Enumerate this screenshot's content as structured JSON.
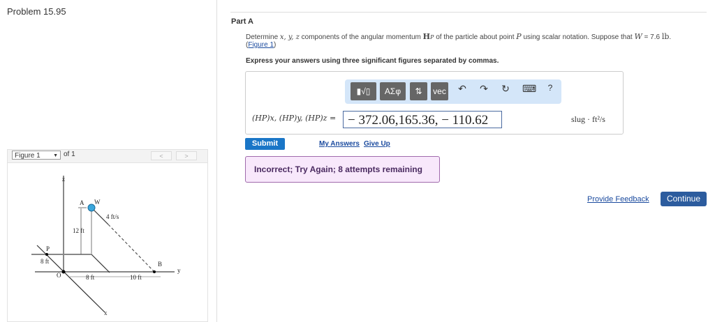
{
  "problem_title": "Problem 15.95",
  "figure_nav": {
    "selected": "Figure 1",
    "of": "of 1",
    "prev": "<",
    "next": ">"
  },
  "figure_labels": {
    "z": "z",
    "y": "y",
    "x": "x",
    "O": "O",
    "P": "P",
    "A": "A",
    "W": "W",
    "B": "B",
    "speed": "4 ft/s",
    "h": "12 ft",
    "p": "8 ft",
    "d1": "8 ft",
    "d2": "10 ft"
  },
  "part": {
    "title": "Part A",
    "question_pre": "Determine ",
    "question_vars": "x, y, z",
    "question_mid": " components of the angular momentum ",
    "question_H": "H",
    "question_sub": "P",
    "question_post": " of the particle about point ",
    "question_P": "P",
    "question_post2": " using scalar notation. Suppose that ",
    "question_W": "W",
    "question_eq": " = 7.6 ",
    "question_unit": "lb",
    "figure_link": "Figure 1",
    "instructions": "Express your answers using three significant figures separated by commas."
  },
  "toolbar": {
    "templates": "▮√▯",
    "greek": "ΑΣφ",
    "arrows": "⇅",
    "vec": "vec",
    "undo": "↶",
    "redo": "↷",
    "reset": "↻",
    "keyboard": "⌨",
    "help": "?"
  },
  "answer": {
    "label": "(HP)x, (HP)y, (HP)z =",
    "value": "− 372.06,165.36, − 110.62",
    "unit": "slug · ft²/s"
  },
  "actions": {
    "submit": "Submit",
    "my_answers": "My Answers",
    "give_up": "Give Up"
  },
  "feedback": "Incorrect; Try Again; 8 attempts remaining",
  "footer": {
    "provide_feedback": "Provide Feedback",
    "continue": "Continue"
  }
}
